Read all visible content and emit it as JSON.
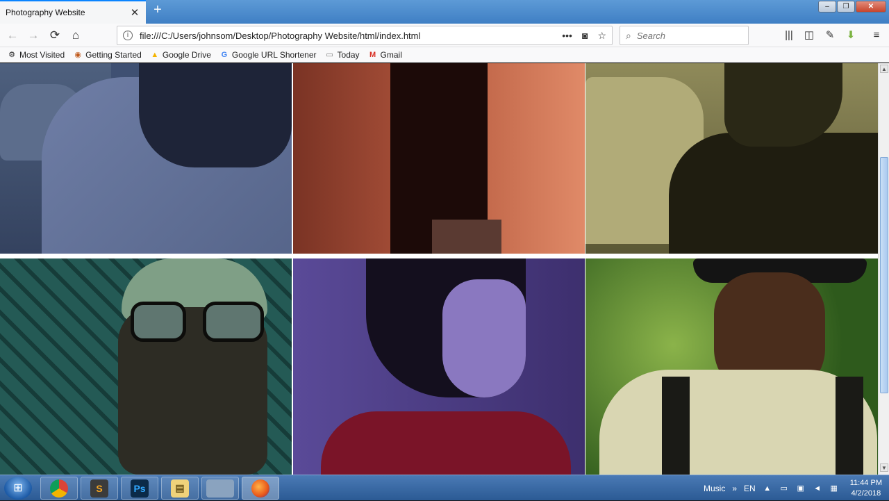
{
  "browser": {
    "tab_title": "Photography Website",
    "tab_close": "✕",
    "new_tab": "+",
    "window_buttons": {
      "minimize": "–",
      "maximize": "❐",
      "close": "✕"
    },
    "url": "file:///C:/Users/johnsom/Desktop/Photography Website/html/index.html",
    "search_placeholder": "Search",
    "nav_icons": {
      "back": "back-arrow-icon",
      "forward": "forward-arrow-icon",
      "reload": "reload-icon",
      "home": "home-icon"
    },
    "toolbar_icons": [
      "library-icon",
      "sidebar-icon",
      "eyedropper-icon",
      "download-icon",
      "menu-icon"
    ]
  },
  "bookmarks": [
    {
      "label": "Most Visited",
      "icon": "gear-icon"
    },
    {
      "label": "Getting Started",
      "icon": "firefox-icon"
    },
    {
      "label": "Google Drive",
      "icon": "google-drive-icon"
    },
    {
      "label": "Google URL Shortener",
      "icon": "google-icon"
    },
    {
      "label": "Today",
      "icon": "folder-icon"
    },
    {
      "label": "Gmail",
      "icon": "gmail-icon"
    }
  ],
  "gallery": {
    "colors": [
      "#3f5072",
      "#b26048",
      "#6f6b45",
      "#1f4e4a",
      "#4d3e86",
      "#3d6a25"
    ]
  },
  "taskbar": {
    "apps": [
      "chrome-icon",
      "sublime-text-icon",
      "photoshop-icon",
      "file-explorer-icon",
      "blank-window-icon",
      "firefox-icon"
    ],
    "tray_label": "Music",
    "tray_arrow": "»",
    "language": "EN",
    "time": "11:44 PM",
    "date": "4/2/2018"
  }
}
